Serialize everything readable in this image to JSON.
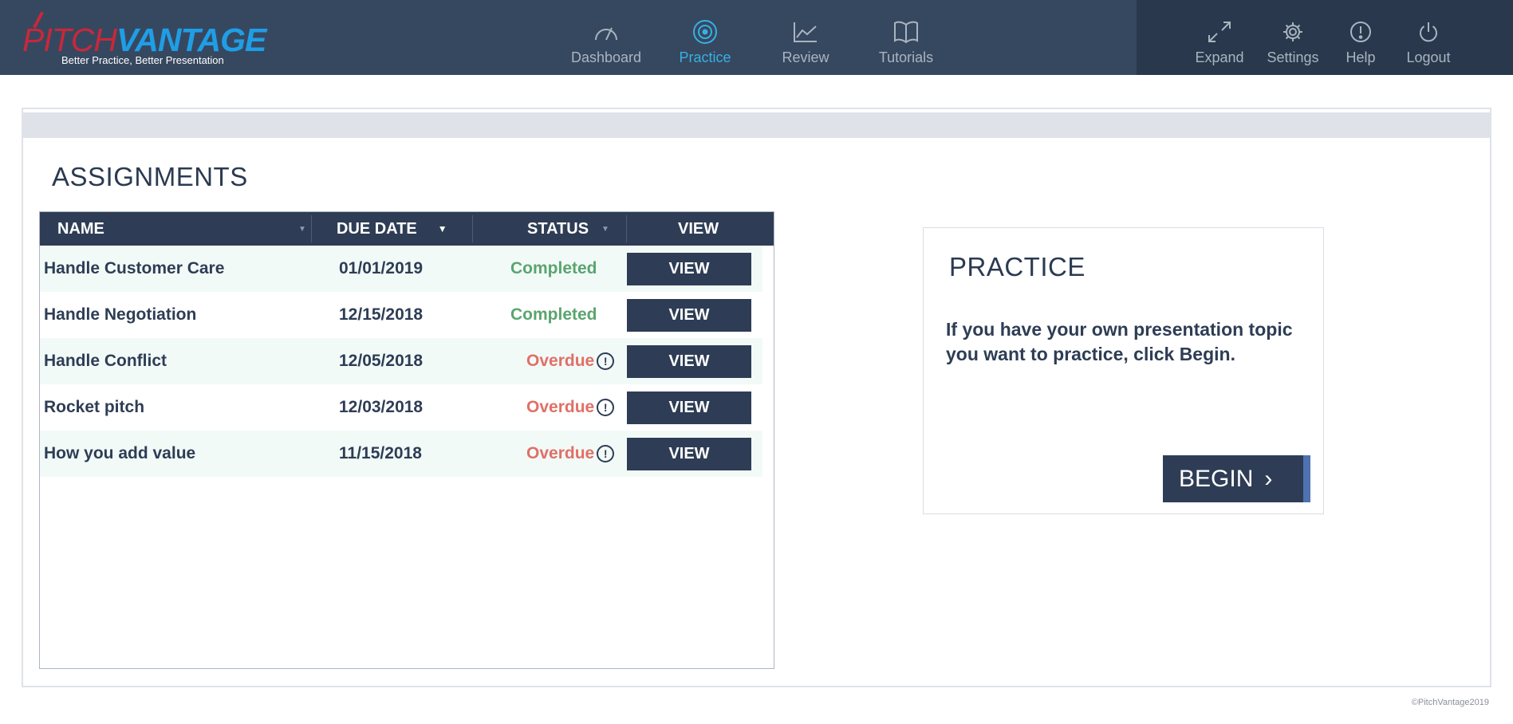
{
  "brand": {
    "logo_pitch": "PITCH",
    "logo_vantage": "VANTAGE",
    "tagline": "Better Practice, Better Presentation"
  },
  "nav": {
    "items": [
      {
        "label": "Dashboard",
        "icon": "gauge-icon",
        "active": false
      },
      {
        "label": "Practice",
        "icon": "target-icon",
        "active": true
      },
      {
        "label": "Review",
        "icon": "line-chart-icon",
        "active": false
      },
      {
        "label": "Tutorials",
        "icon": "book-icon",
        "active": false
      }
    ],
    "utility": [
      {
        "label": "Expand",
        "icon": "expand-icon"
      },
      {
        "label": "Settings",
        "icon": "gear-icon"
      },
      {
        "label": "Help",
        "icon": "exclamation-circle-icon"
      },
      {
        "label": "Logout",
        "icon": "power-icon"
      }
    ]
  },
  "assignments": {
    "title": "ASSIGNMENTS",
    "columns": {
      "name": "NAME",
      "due_date": "DUE DATE",
      "status": "STATUS",
      "view": "VIEW"
    },
    "rows": [
      {
        "name": "Handle Customer Care",
        "due": "01/01/2019",
        "status": "Completed",
        "overdue": false,
        "view": "VIEW"
      },
      {
        "name": "Handle Negotiation",
        "due": "12/15/2018",
        "status": "Completed",
        "overdue": false,
        "view": "VIEW"
      },
      {
        "name": "Handle Conflict",
        "due": "12/05/2018",
        "status": "Overdue",
        "overdue": true,
        "view": "VIEW"
      },
      {
        "name": "Rocket pitch",
        "due": "12/03/2018",
        "status": "Overdue",
        "overdue": true,
        "view": "VIEW"
      },
      {
        "name": "How you add value",
        "due": "11/15/2018",
        "status": "Overdue",
        "overdue": true,
        "view": "VIEW"
      }
    ]
  },
  "practice": {
    "title": "PRACTICE",
    "text": "If you have your own presentation topic you want to practice, click Begin.",
    "button": "BEGIN"
  },
  "footer": {
    "copyright": "©PitchVantage2019"
  },
  "colors": {
    "nav_bg": "#364860",
    "nav_dark": "#29384c",
    "active": "#36b0e3",
    "completed": "#5aa56e",
    "overdue": "#e07067"
  }
}
